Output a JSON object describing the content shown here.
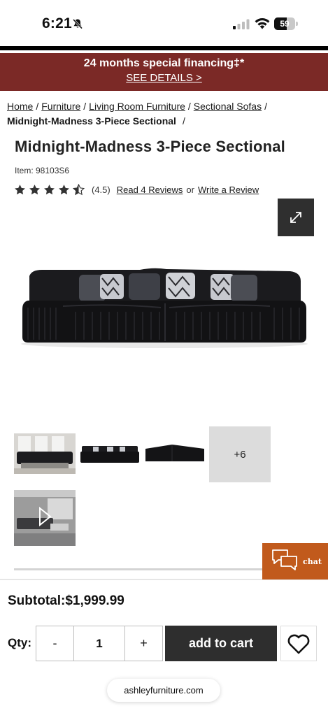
{
  "status_bar": {
    "time": "6:21",
    "battery_level": 59,
    "icons": [
      "bell-slash-icon",
      "cellular-signal-icon",
      "wifi-icon",
      "battery-icon"
    ]
  },
  "promo": {
    "title": "24 months special financing‡*",
    "link_label": "SEE DETAILS >",
    "background_color": "#7b2926"
  },
  "breadcrumb": {
    "items": [
      "Home",
      "Furniture",
      "Living Room Furniture",
      "Sectional Sofas"
    ],
    "separator": "/",
    "current": "Midnight-Madness 3-Piece Sectional"
  },
  "product": {
    "title": "Midnight-Madness 3-Piece Sectional",
    "item_label": "Item: 98103S6",
    "rating": 4.5,
    "rating_label": "(4.5)",
    "read_reviews_label": "Read 4 Reviews",
    "or_label": "or",
    "write_review_label": "Write a Review",
    "expand_icon": "expand-arrows-icon"
  },
  "gallery": {
    "more_label": "+6",
    "thumbnails": [
      "room-scene-photo",
      "sectional-front-photo",
      "sectional-back-photo",
      "more-photos",
      "video-thumbnail"
    ]
  },
  "chat": {
    "label": "chat",
    "icon": "chat-bubbles-icon",
    "color": "#c15a1c"
  },
  "cart": {
    "subtotal_label": "Subtotal:$1,999.99",
    "qty_label": "Qty:",
    "minus_label": "-",
    "quantity": "1",
    "plus_label": "+",
    "add_to_cart_label": "add to cart",
    "wishlist_icon": "heart-icon"
  },
  "browser": {
    "url": "ashleyfurniture.com"
  }
}
